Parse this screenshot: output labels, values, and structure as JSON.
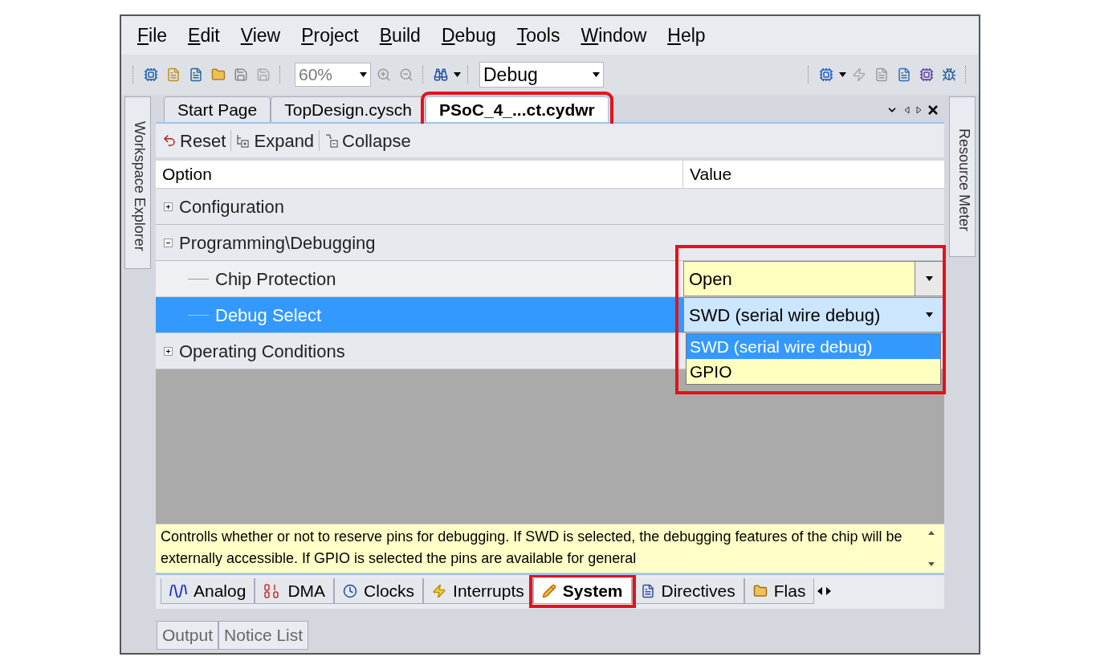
{
  "menu": [
    "File",
    "Edit",
    "View",
    "Project",
    "Build",
    "Debug",
    "Tools",
    "Window",
    "Help"
  ],
  "toolbar": {
    "zoom": "60%",
    "configuration": "Debug"
  },
  "side_tabs": {
    "left": "Workspace Explorer",
    "right": "Resource Meter"
  },
  "doc_tabs": [
    {
      "label": "Start Page",
      "selected": false,
      "highlighted": false
    },
    {
      "label": "TopDesign.cysch",
      "selected": false,
      "highlighted": false
    },
    {
      "label": "PSoC_4_...ct.cydwr",
      "selected": true,
      "highlighted": true
    }
  ],
  "doc_toolbar": [
    {
      "kind": "reset",
      "label": "Reset"
    },
    {
      "kind": "expand",
      "label": "Expand"
    },
    {
      "kind": "collapse",
      "label": "Collapse"
    }
  ],
  "grid": {
    "columns": [
      "Option",
      "Value"
    ],
    "value_highlight": true,
    "rows": [
      {
        "label": "Configuration",
        "expanded": false
      },
      {
        "label": "Programming\\Debugging",
        "expanded": true,
        "children": [
          {
            "label": "Chip Protection",
            "value": "Open",
            "selected": false
          },
          {
            "label": "Debug Select",
            "value": "SWD (serial wire debug)",
            "selected": true,
            "options": [
              {
                "label": "SWD (serial wire debug)",
                "selected": true
              },
              {
                "label": "GPIO",
                "selected": false
              }
            ]
          }
        ]
      },
      {
        "label": "Operating Conditions",
        "expanded": false
      }
    ]
  },
  "help_text": "Controlls whether or not to reserve pins for debugging. If SWD is selected, the debugging features of the chip will be externally accessible. If GPIO is selected the pins are available for general",
  "bottom_tabs": [
    {
      "kind": "wave",
      "label": "Analog",
      "selected": false,
      "highlighted": false
    },
    {
      "kind": "binary",
      "label": "DMA",
      "selected": false,
      "highlighted": false
    },
    {
      "kind": "clock",
      "label": "Clocks",
      "selected": false,
      "highlighted": false
    },
    {
      "kind": "bolt",
      "label": "Interrupts",
      "selected": false,
      "highlighted": false
    },
    {
      "kind": "pencil",
      "label": "System",
      "selected": true,
      "highlighted": true
    },
    {
      "kind": "document",
      "label": "Directives",
      "selected": false,
      "highlighted": false
    },
    {
      "kind": "flash",
      "label": "Flas",
      "selected": false,
      "highlighted": false
    }
  ],
  "output_tabs": [
    {
      "label": "Output",
      "selected": false
    },
    {
      "label": "Notice List",
      "selected": false
    }
  ]
}
